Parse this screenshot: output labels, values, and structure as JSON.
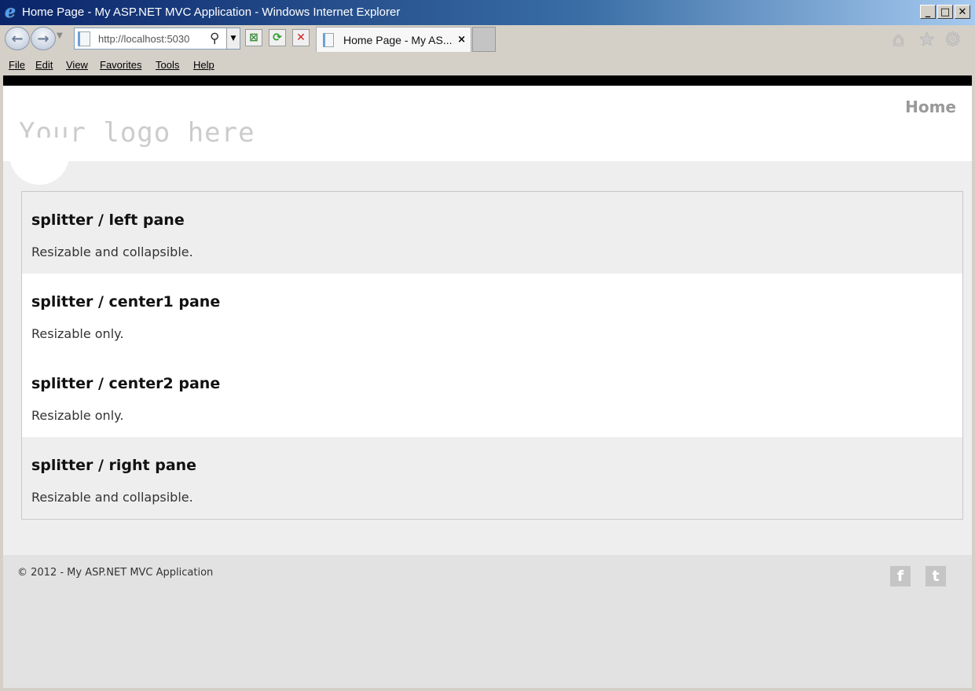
{
  "window": {
    "title": "Home Page - My ASP.NET MVC Application - Windows Internet Explorer"
  },
  "window_buttons": {
    "minimize": "_",
    "maximize": "□",
    "close": "✕"
  },
  "address_bar": {
    "url": "http://localhost:5030"
  },
  "tab": {
    "label": "Home Page - My AS...",
    "close": "×"
  },
  "menu": [
    "File",
    "Edit",
    "View",
    "Favorites",
    "Tools",
    "Help"
  ],
  "header": {
    "logo": "Your logo here",
    "nav_home": "Home"
  },
  "panes": [
    {
      "title": "splitter / left pane",
      "description": "Resizable and collapsible."
    },
    {
      "title": "splitter / center1 pane",
      "description": "Resizable only."
    },
    {
      "title": "splitter / center2 pane",
      "description": "Resizable only."
    },
    {
      "title": "splitter / right pane",
      "description": "Resizable and collapsible."
    }
  ],
  "footer": {
    "copyright": "© 2012 - My ASP.NET MVC Application"
  },
  "icons": [
    "ie-logo-icon",
    "back-icon",
    "forward-icon",
    "page-icon",
    "search-icon",
    "compatibility-icon",
    "refresh-icon",
    "stop-icon",
    "home-icon",
    "favorites-star-icon",
    "gear-icon",
    "facebook-icon",
    "twitter-icon"
  ]
}
